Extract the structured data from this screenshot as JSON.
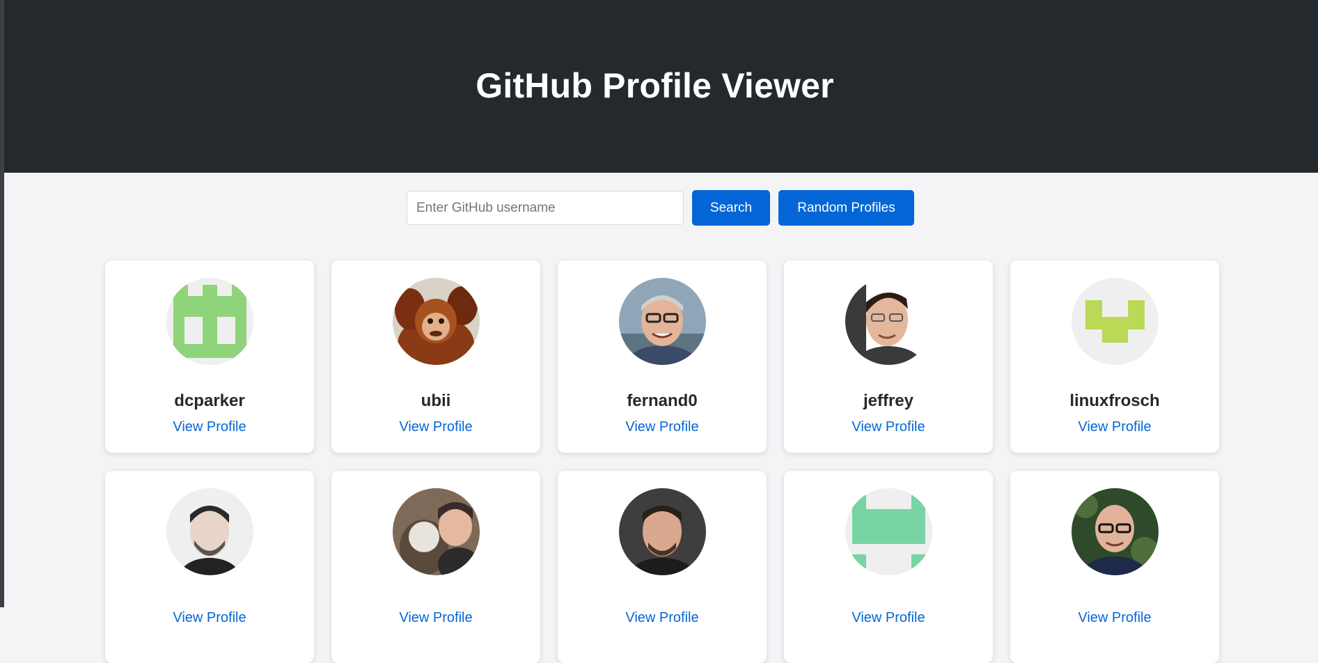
{
  "header": {
    "title": "GitHub Profile Viewer"
  },
  "search": {
    "placeholder": "Enter GitHub username",
    "value": "",
    "search_label": "Search",
    "random_label": "Random Profiles"
  },
  "colors": {
    "header_bg": "#24292e",
    "accent": "#0466d6",
    "page_bg": "#f4f4f7"
  },
  "profiles": [
    {
      "username": "dcparker",
      "link_label": "View Profile",
      "avatar": "identicon-green"
    },
    {
      "username": "ubii",
      "link_label": "View Profile",
      "avatar": "photo-orangutan"
    },
    {
      "username": "fernand0",
      "link_label": "View Profile",
      "avatar": "photo-man-glasses"
    },
    {
      "username": "jeffrey",
      "link_label": "View Profile",
      "avatar": "photo-man-glasses"
    },
    {
      "username": "linuxfrosch",
      "link_label": "View Profile",
      "avatar": "identicon-lime"
    },
    {
      "username": "",
      "link_label": "View Profile",
      "avatar": "photo-man"
    },
    {
      "username": "",
      "link_label": "View Profile",
      "avatar": "photo-woman-dog"
    },
    {
      "username": "",
      "link_label": "View Profile",
      "avatar": "photo-man"
    },
    {
      "username": "",
      "link_label": "View Profile",
      "avatar": "identicon-mint"
    },
    {
      "username": "",
      "link_label": "View Profile",
      "avatar": "photo-man-glasses"
    }
  ]
}
